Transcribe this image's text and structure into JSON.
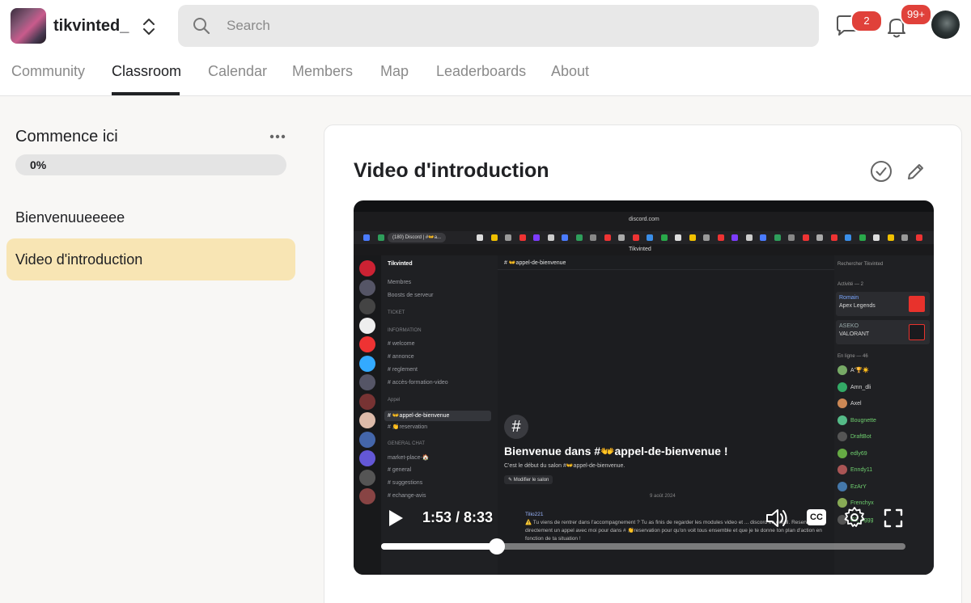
{
  "header": {
    "community_name": "tikvinted_",
    "search_placeholder": "Search",
    "chat_badge": "2",
    "notifications_badge": "99+"
  },
  "tabs": [
    {
      "label": "Community",
      "active": false
    },
    {
      "label": "Classroom",
      "active": true
    },
    {
      "label": "Calendar",
      "active": false
    },
    {
      "label": "Members",
      "active": false
    },
    {
      "label": "Map",
      "active": false
    },
    {
      "label": "Leaderboards",
      "active": false
    },
    {
      "label": "About",
      "active": false
    }
  ],
  "course": {
    "title": "Commence ici",
    "progress_label": "0%",
    "progress": 0,
    "lessons": [
      {
        "label": "Bienvenuueeeee",
        "active": false
      },
      {
        "label": "Video d'introduction",
        "active": true
      }
    ]
  },
  "lesson": {
    "title": "Video d'introduction"
  },
  "video": {
    "current_time": "1:53",
    "duration": "8:33",
    "time_display": "1:53 / 8:33",
    "progress": 0.22,
    "cc_label": "CC",
    "screen": {
      "url": "discord.com",
      "tab_label": "(180) Discord | #👐a...",
      "app_title": "Tikvinted",
      "server_name": "Tikvinted",
      "channels": [
        {
          "label": "Membres",
          "type": "item"
        },
        {
          "label": "Boosts de serveur",
          "type": "item"
        },
        {
          "label": "TICKET",
          "type": "cat"
        },
        {
          "label": "INFORMATION",
          "type": "cat"
        },
        {
          "label": "# welcome",
          "type": "item"
        },
        {
          "label": "# annonce",
          "type": "item"
        },
        {
          "label": "# reglement",
          "type": "item"
        },
        {
          "label": "# accès-formation-video",
          "type": "item"
        },
        {
          "label": "Appel",
          "type": "cat"
        },
        {
          "label": "# 👐appel-de-bienvenue",
          "type": "sel"
        },
        {
          "label": "# 👏reservation",
          "type": "item"
        },
        {
          "label": "GENERAL CHAT",
          "type": "cat"
        },
        {
          "label": "market-place-🏠",
          "type": "item"
        },
        {
          "label": "# general",
          "type": "item"
        },
        {
          "label": "# suggestions",
          "type": "item"
        },
        {
          "label": "# echange-avis",
          "type": "item"
        }
      ],
      "chat_channel": "# 👐appel-de-bienvenue",
      "welcome_title": "Bienvenue dans #👐appel-de-bienvenue !",
      "welcome_sub": "C'est le début du salon #👐appel-de-bienvenue.",
      "edit_button": "✎ Modifier le salon",
      "date_divider": "9 août 2024",
      "message_author": "Tilio221",
      "message_text": "⚠️ Tu viens de rentrer dans l'accompagnement ? Tu as finis de regarder les modules video et ... discord en detail. Reserve directement un appel avec moi pour dans # 👏reservation pour qu'on voit tous ensemble et que je te donne ton plan d'action en fonction de ta situation !",
      "member_search": "Rechercher Tikvinted",
      "activity_header": "Activité — 2",
      "activities": [
        {
          "name": "Romain",
          "game": "Apex Legends"
        },
        {
          "name": "ASEKO",
          "game": "VALORANT"
        }
      ],
      "online_header": "En ligne — 46",
      "members": [
        "A'🏆☀️",
        "Amn_dli",
        "Axel",
        "Bougnette",
        "DraftBot",
        "edly69",
        "Enndy11",
        "EzArY",
        "Frenchyx",
        "G2_sggg"
      ]
    }
  }
}
